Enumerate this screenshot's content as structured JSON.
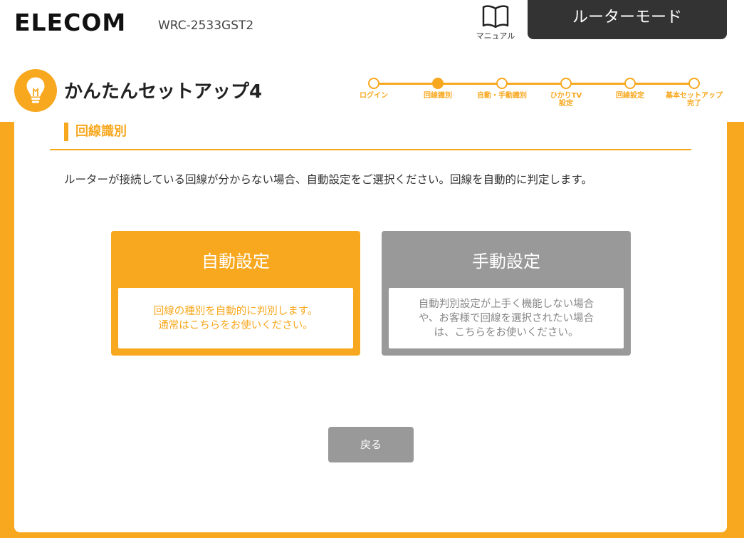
{
  "header": {
    "logo": "ELECOM",
    "model": "WRC-2533GST2",
    "manual_label": "マニュアル",
    "mode_label": "ルーターモード"
  },
  "setup": {
    "title": "かんたんセットアップ4"
  },
  "stepper": {
    "steps": [
      {
        "label": "ログイン"
      },
      {
        "label": "回線識別"
      },
      {
        "label": "自動・手動識別"
      },
      {
        "label": "ひかりTV\n設定"
      },
      {
        "label": "回線設定"
      },
      {
        "label": "基本セットアップ\n完了"
      }
    ],
    "current_index": 1
  },
  "section": {
    "title": "回線識別",
    "description": "ルーターが接続している回線が分からない場合、自動設定をご選択ください。回線を自動的に判定します。"
  },
  "cards": {
    "auto": {
      "title": "自動設定",
      "body": "回線の種別を自動的に判別します。\n通常はこちらをお使いください。"
    },
    "manual": {
      "title": "手動設定",
      "body": "自動判別設定が上手く機能しない場合\nや、お客様で回線を選択されたい場合\nは、こちらをお使いください。"
    }
  },
  "footer": {
    "back_label": "戻る"
  },
  "colors": {
    "accent": "#f8a81f",
    "gray": "#999999",
    "dark": "#333333"
  },
  "icons": {
    "manual": "book-icon",
    "setup": "lightbulb-icon"
  }
}
